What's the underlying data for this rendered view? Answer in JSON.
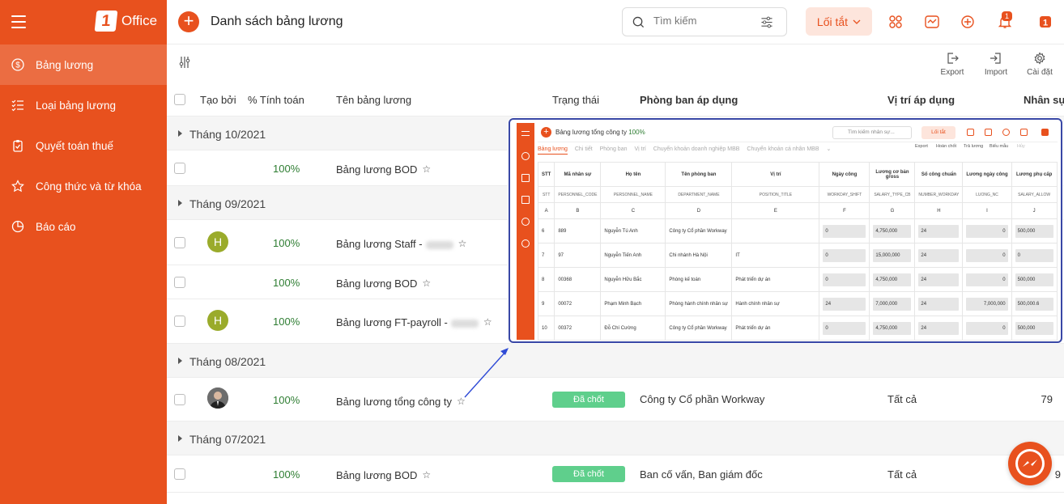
{
  "sidebar": {
    "logo_text": "Office",
    "items": [
      {
        "label": "Bảng lương",
        "icon": "dollar-circle-icon",
        "active": true
      },
      {
        "label": "Loại bảng lương",
        "icon": "list-check-icon",
        "active": false
      },
      {
        "label": "Quyết toán thuế",
        "icon": "clipboard-check-icon",
        "active": false
      },
      {
        "label": "Công thức và từ khóa",
        "icon": "star-icon",
        "active": false
      },
      {
        "label": "Báo cáo",
        "icon": "pie-chart-icon",
        "active": false
      }
    ]
  },
  "header": {
    "title": "Danh sách bảng lương",
    "search_placeholder": "Tìm kiếm",
    "shortcut_label": "Lối tắt",
    "notification_count": "1"
  },
  "toolbar": {
    "export_label": "Export",
    "import_label": "Import",
    "settings_label": "Cài đặt"
  },
  "table": {
    "columns": {
      "created_by": "Tạo bởi",
      "calc_pct": "% Tính toán",
      "name": "Tên bảng lương",
      "status": "Trạng thái",
      "department": "Phòng ban áp dụng",
      "position": "Vị trí áp dụng",
      "staff": "Nhân sự"
    },
    "groups": [
      {
        "label": "Tháng 10/2021",
        "rows": [
          {
            "pct": "100%",
            "name": "Bảng lương BOD"
          }
        ]
      },
      {
        "label": "Tháng 09/2021",
        "rows": [
          {
            "avatar": "H",
            "pct": "100%",
            "name": "Bảng lương Staff -"
          },
          {
            "pct": "100%",
            "name": "Bảng lương BOD"
          },
          {
            "avatar": "H",
            "pct": "100%",
            "name": "Bảng lương FT-payroll -"
          }
        ]
      },
      {
        "label": "Tháng 08/2021",
        "rows": [
          {
            "pct": "100%",
            "name": "Bảng lương tổng công ty",
            "status": "Đã chốt",
            "department": "Công ty Cổ phần Workway",
            "position": "Tất cả",
            "count": "79"
          }
        ]
      },
      {
        "label": "Tháng 07/2021",
        "rows": [
          {
            "pct": "100%",
            "name": "Bảng lương BOD",
            "status": "Đã chốt",
            "department": "Ban cố vấn, Ban giám đốc",
            "position": "Tất cả",
            "count": "9"
          }
        ]
      }
    ]
  },
  "overlay": {
    "title": "Bảng lương tổng công ty",
    "title_pct": "100%",
    "search_placeholder": "Tìm kiếm nhân sự...",
    "shortcut_label": "Lối tắt",
    "tabs": [
      "Bảng lương",
      "Chi tiết",
      "Phòng ban",
      "Vị trí",
      "Chuyển khoản doanh nghiệp MBB",
      "Chuyển khoản cá nhân MBB"
    ],
    "actions": [
      "Export",
      "Hoàn chốt",
      "Trả lương",
      "Biểu mẫu",
      "Hủy"
    ],
    "headers": [
      "STT",
      "Mã nhân sự",
      "Họ tên",
      "Tên phòng ban",
      "Vị trí",
      "Ngày công",
      "Lương cơ bản gross",
      "Số công chuẩn",
      "Lương ngày công",
      "Lương phụ cấp"
    ],
    "codes": [
      "STT",
      "PERSONNEL_CODE",
      "PERSONNEL_NAME",
      "DEPARTMENT_NAME",
      "POSITION_TITLE",
      "WORKDAY_SHIFT",
      "SALARY_TYPE_CB",
      "NUMBER_WORKDAY",
      "LUONG_NC",
      "SALARY_ALLOW"
    ],
    "letters": [
      "A",
      "B",
      "C",
      "D",
      "E",
      "F",
      "G",
      "H",
      "I",
      "J"
    ],
    "rows": [
      [
        "6",
        "889",
        "Nguyễn Tú Anh",
        "Công ty Cổ phần Workway",
        "",
        "0",
        "4,750,000",
        "24",
        "0",
        "500,000"
      ],
      [
        "7",
        "97",
        "Nguyễn Tiến Anh",
        "Chi nhánh Hà Nội",
        "IT",
        "0",
        "15,000,000",
        "24",
        "0",
        "0"
      ],
      [
        "8",
        "00368",
        "Nguyễn Hữu Bắc",
        "Phòng kế toán",
        "Phát triển dự án",
        "0",
        "4,750,000",
        "24",
        "0",
        "500,000"
      ],
      [
        "9",
        "00072",
        "Phạm Minh Bạch",
        "Phòng hành chính nhân sự",
        "Hành chính nhân sự",
        "24",
        "7,000,000",
        "24",
        "7,000,000",
        "500,000.6"
      ],
      [
        "10",
        "00372",
        "Đỗ Chí Cường",
        "Công ty Cổ phần Workway",
        "Phát triển dự án",
        "0",
        "4,750,000",
        "24",
        "0",
        "500,000"
      ]
    ]
  },
  "colors": {
    "brand": "#e8511e",
    "status_green": "#5fcf8c",
    "pct_green": "#2e7d32",
    "overlay_border": "#3948a6"
  }
}
